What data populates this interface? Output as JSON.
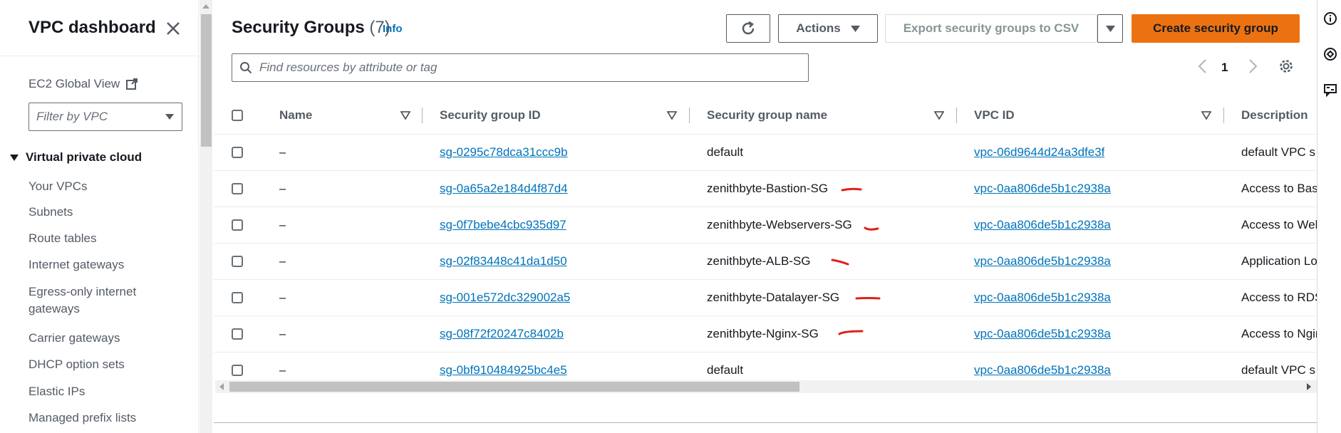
{
  "sidebar": {
    "title": "VPC dashboard",
    "global_view": "EC2 Global View",
    "filter_placeholder": "Filter by VPC",
    "section": "Virtual private cloud",
    "items": [
      "Your VPCs",
      "Subnets",
      "Route tables",
      "Internet gateways",
      "Egress-only internet gateways",
      "Carrier gateways",
      "DHCP option sets",
      "Elastic IPs",
      "Managed prefix lists"
    ]
  },
  "header": {
    "title": "Security Groups",
    "count": "(7)",
    "info": "Info",
    "actions_label": "Actions",
    "export_label": "Export security groups to CSV",
    "create_label": "Create security group",
    "search_placeholder": "Find resources by attribute or tag",
    "page_number": "1"
  },
  "table": {
    "columns": [
      "Name",
      "Security group ID",
      "Security group name",
      "VPC ID",
      "Description"
    ],
    "rows": [
      {
        "name": "–",
        "id": "sg-0295c78dca31ccc9b",
        "group_name": "default",
        "vpc": "vpc-06d9644d24a3dfe3f",
        "desc": "default VPC s"
      },
      {
        "name": "–",
        "id": "sg-0a65a2e184d4f87d4",
        "group_name": "zenithbyte-Bastion-SG",
        "vpc": "vpc-0aa806de5b1c2938a",
        "desc": "Access to Bast"
      },
      {
        "name": "–",
        "id": "sg-0f7bebe4cbc935d97",
        "group_name": "zenithbyte-Webservers-SG",
        "vpc": "vpc-0aa806de5b1c2938a",
        "desc": "Access to Web"
      },
      {
        "name": "–",
        "id": "sg-02f83448c41da1d50",
        "group_name": "zenithbyte-ALB-SG",
        "vpc": "vpc-0aa806de5b1c2938a",
        "desc": "Application Lo"
      },
      {
        "name": "–",
        "id": "sg-001e572dc329002a5",
        "group_name": "zenithbyte-Datalayer-SG",
        "vpc": "vpc-0aa806de5b1c2938a",
        "desc": "Access to RDS"
      },
      {
        "name": "–",
        "id": "sg-08f72f20247c8402b",
        "group_name": "zenithbyte-Nginx-SG",
        "vpc": "vpc-0aa806de5b1c2938a",
        "desc": "Access to Ngin"
      },
      {
        "name": "–",
        "id": "sg-0bf910484925bc4e5",
        "group_name": "default",
        "vpc": "vpc-0aa806de5b1c2938a",
        "desc": "default VPC s"
      }
    ]
  },
  "colors": {
    "primary": "#ec7211",
    "link": "#0073bb",
    "annotation": "#e0201c"
  },
  "icons": [
    "close-icon",
    "external-link-icon",
    "caret-down-icon",
    "search-icon",
    "refresh-icon",
    "chevron-left-icon",
    "chevron-right-icon",
    "gear-icon",
    "sort-icon",
    "info-icon",
    "shield-icon",
    "feedback-icon"
  ]
}
